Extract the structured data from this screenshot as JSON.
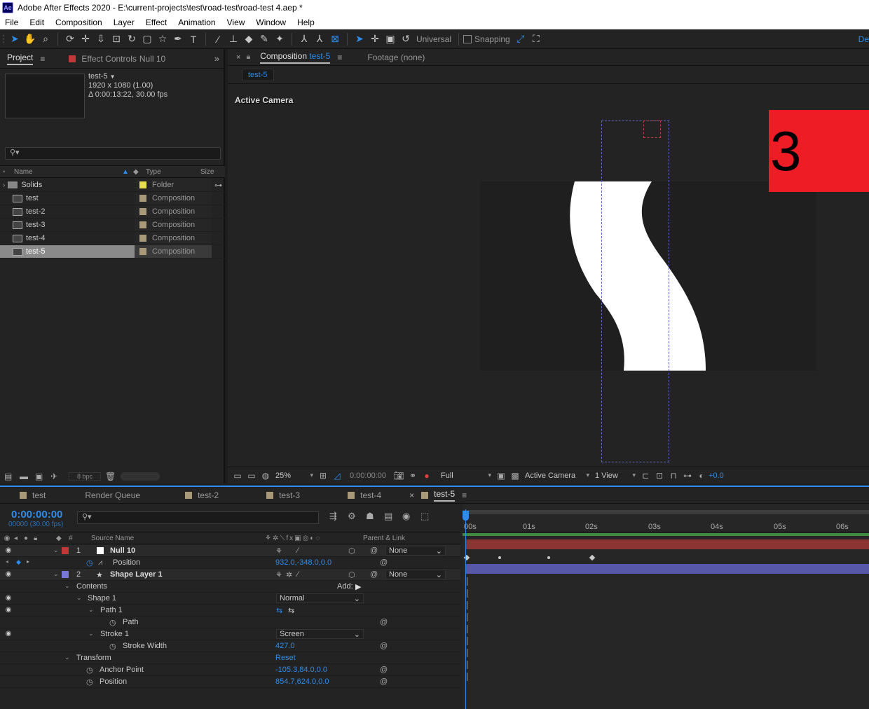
{
  "window": {
    "title": "Adobe After Effects 2020 - E:\\current-projects\\test\\road-test\\road-test 4.aep *",
    "logo": "Ae"
  },
  "menu": [
    "File",
    "Edit",
    "Composition",
    "Layer",
    "Effect",
    "Animation",
    "View",
    "Window",
    "Help"
  ],
  "toolbar": {
    "axis_mode": "Universal",
    "snapping": "Snapping",
    "workspace": "De"
  },
  "project": {
    "tab_project": "Project",
    "tab_effect_controls": "Effect Controls",
    "effect_target": "Null 10",
    "comp_name": "test-5",
    "comp_res": "1920 x 1080 (1.00)",
    "comp_duration": "Δ 0:00:13:22, 30.00 fps",
    "search_placeholder": "",
    "columns": {
      "name": "Name",
      "type": "Type",
      "size": "Size"
    },
    "items": [
      {
        "name": "Solids",
        "type": "Folder",
        "kind": "folder",
        "label_color": "#e8e04a"
      },
      {
        "name": "test",
        "type": "Composition",
        "kind": "comp",
        "label_color": "#a89a78"
      },
      {
        "name": "test-2",
        "type": "Composition",
        "kind": "comp",
        "label_color": "#a89a78"
      },
      {
        "name": "test-3",
        "type": "Composition",
        "kind": "comp",
        "label_color": "#a89a78"
      },
      {
        "name": "test-4",
        "type": "Composition",
        "kind": "comp",
        "label_color": "#a89a78"
      },
      {
        "name": "test-5",
        "type": "Composition",
        "kind": "comp",
        "label_color": "#a89a78",
        "selected": true
      }
    ],
    "bpc": "8 bpc"
  },
  "viewer": {
    "tab_comp_prefix": "Composition",
    "tab_comp_name": "test-5",
    "tab_footage": "Footage (none)",
    "sub_tab": "test-5",
    "active_camera_label": "Active Camera",
    "badge": "3",
    "zoom": "25%",
    "timecode": "0:00:00:00",
    "resolution": "Full",
    "camera": "Active Camera",
    "views": "1 View",
    "exposure": "+0.0"
  },
  "timeline": {
    "tabs": [
      {
        "name": "test",
        "color": "#a89a78"
      },
      {
        "name": "Render Queue",
        "color": ""
      },
      {
        "name": "test-2",
        "color": "#a89a78"
      },
      {
        "name": "test-3",
        "color": "#a89a78"
      },
      {
        "name": "test-4",
        "color": "#a89a78"
      },
      {
        "name": "test-5",
        "color": "#a89a78",
        "active": true
      }
    ],
    "current_time": "0:00:00:00",
    "frames": "00000 (30.00 fps)",
    "col_source": "Source Name",
    "col_parent": "Parent & Link",
    "ruler": [
      "00s",
      "01s",
      "02s",
      "03s",
      "04s",
      "05s",
      "06s"
    ],
    "layer1": {
      "num": "1",
      "name": "Null 10",
      "color": "#c03838",
      "parent": "None"
    },
    "layer1_position_label": "Position",
    "layer1_position_value": "932.0,-348.0,0.0",
    "layer2": {
      "num": "2",
      "name": "Shape Layer 1",
      "color": "#7878d8",
      "parent": "None"
    },
    "contents": "Contents",
    "add": "Add:",
    "shape1": "Shape 1",
    "blend_normal": "Normal",
    "path1": "Path 1",
    "path": "Path",
    "stroke1": "Stroke 1",
    "blend_screen": "Screen",
    "stroke_width_label": "Stroke Width",
    "stroke_width_value": "427.0",
    "transform": "Transform",
    "reset": "Reset",
    "anchor_label": "Anchor Point",
    "anchor_value": "-105.3,84.0,0.0",
    "position_label": "Position",
    "position_value": "854.7,624.0,0.0"
  }
}
